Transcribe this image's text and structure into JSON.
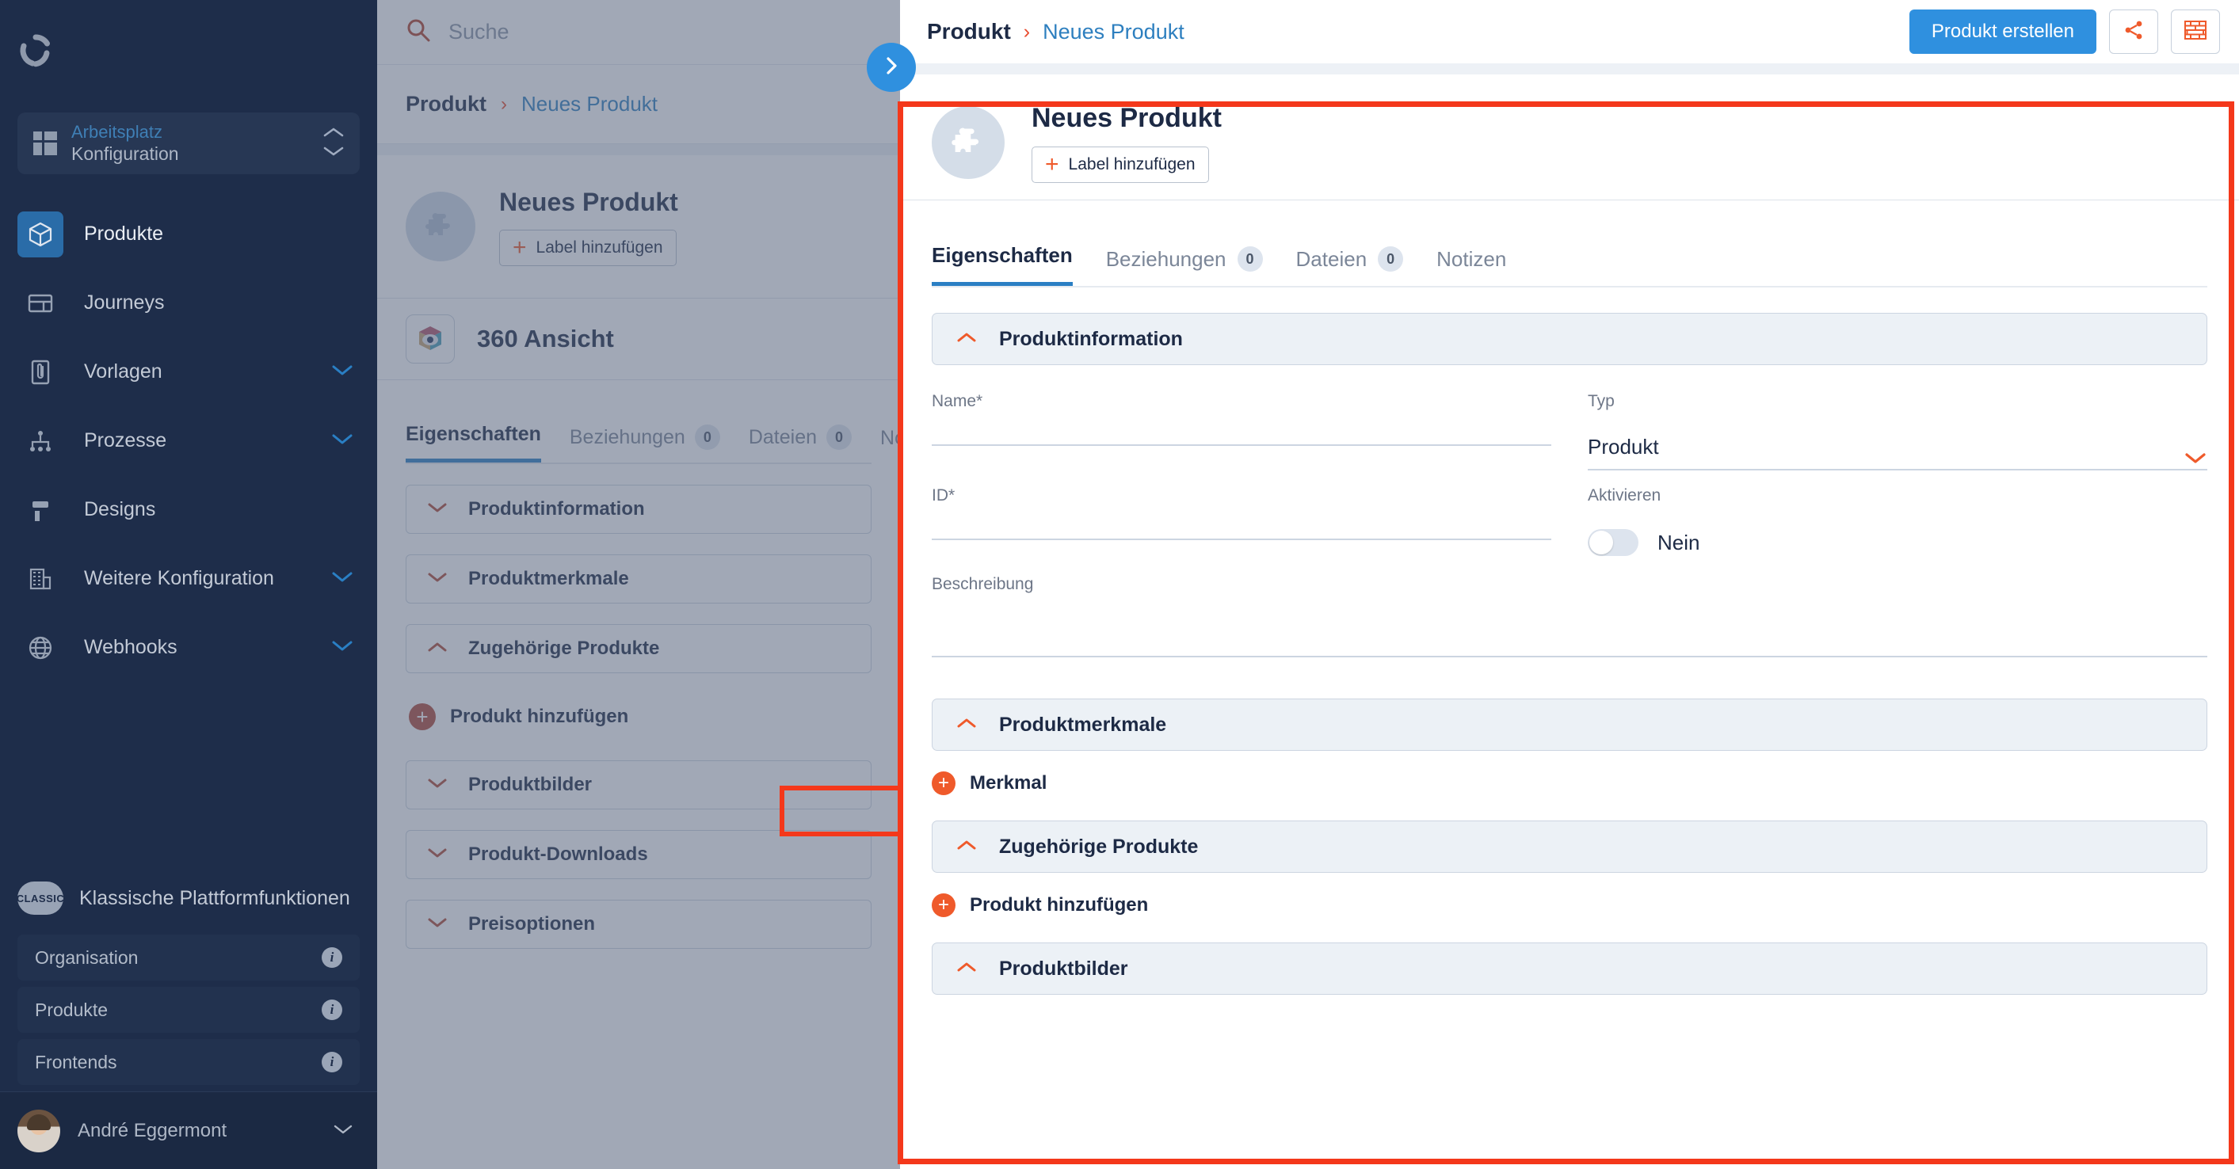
{
  "sidebar": {
    "logo_icon": "cycle-logo-icon",
    "workspace": {
      "icon": "grid-icon",
      "title": "Arbeitsplatz",
      "subtitle": "Konfiguration",
      "chevron_up_icon": "chevron-up-icon",
      "chevron_down_icon": "chevron-down-icon"
    },
    "items": [
      {
        "label": "Produkte",
        "icon": "cube-icon",
        "active": true,
        "caret": false
      },
      {
        "label": "Journeys",
        "icon": "journey-icon",
        "active": false,
        "caret": false
      },
      {
        "label": "Vorlagen",
        "icon": "document-clip-icon",
        "active": false,
        "caret": true
      },
      {
        "label": "Prozesse",
        "icon": "hierarchy-icon",
        "active": false,
        "caret": true
      },
      {
        "label": "Designs",
        "icon": "paint-roller-icon",
        "active": false,
        "caret": false
      },
      {
        "label": "Weitere Konfiguration",
        "icon": "building-icon",
        "active": false,
        "caret": true
      },
      {
        "label": "Webhooks",
        "icon": "globe-icon",
        "active": false,
        "caret": true
      }
    ],
    "classic": {
      "badge": "CLASSIC",
      "label": "Klassische Plattformfunktionen",
      "items": [
        {
          "label": "Organisation",
          "info_icon": "info-icon"
        },
        {
          "label": "Produkte",
          "info_icon": "info-icon"
        },
        {
          "label": "Frontends",
          "info_icon": "info-icon"
        }
      ]
    },
    "user": {
      "name": "André Eggermont",
      "avatar_icon": "user-avatar",
      "chevron_icon": "chevron-down-icon"
    }
  },
  "middle_panel": {
    "search": {
      "icon": "search-icon",
      "placeholder": "Suche",
      "value": ""
    },
    "breadcrumb": {
      "root": "Produkt",
      "separator": "›",
      "leaf": "Neues Produkt"
    },
    "hero": {
      "avatar_icon": "puzzle-piece-icon",
      "title": "Neues Produkt",
      "add_label_button": "Label hinzufügen",
      "plus_icon": "plus-icon"
    },
    "view_card": {
      "icon": "360-view-icon",
      "title": "360 Ansicht"
    },
    "tabs": [
      {
        "label": "Eigenschaften",
        "count": null,
        "active": true
      },
      {
        "label": "Beziehungen",
        "count": "0",
        "active": false
      },
      {
        "label": "Dateien",
        "count": "0",
        "active": false
      },
      {
        "label": "Notizen",
        "count": null,
        "active": false
      }
    ],
    "accordions": [
      {
        "label": "Produktinformation",
        "expanded": false
      },
      {
        "label": "Produktmerkmale",
        "expanded": false
      },
      {
        "label": "Zugehörige Produkte",
        "expanded": true
      }
    ],
    "add_product": {
      "label": "Produkt hinzufügen",
      "icon": "plus-circle-icon",
      "highlighted": true
    },
    "accordions_after": [
      {
        "label": "Produktbilder",
        "expanded": false
      },
      {
        "label": "Produkt-Downloads",
        "expanded": false
      },
      {
        "label": "Preisoptionen",
        "expanded": false
      }
    ],
    "expand_toggle": {
      "icon": "chevron-right-icon"
    }
  },
  "right_panel": {
    "topbar": {
      "breadcrumb_root": "Produkt",
      "breadcrumb_separator": "›",
      "breadcrumb_leaf": "Neues Produkt",
      "primary_button": "Produkt erstellen",
      "share_icon": "share-icon",
      "wall_icon": "brick-wall-icon"
    },
    "hero": {
      "avatar_icon": "puzzle-piece-icon",
      "title": "Neues Produkt",
      "add_label_button": "Label hinzufügen",
      "plus_icon": "plus-icon"
    },
    "tabs": [
      {
        "label": "Eigenschaften",
        "count": null,
        "active": true
      },
      {
        "label": "Beziehungen",
        "count": "0",
        "active": false
      },
      {
        "label": "Dateien",
        "count": "0",
        "active": false
      },
      {
        "label": "Notizen",
        "count": null,
        "active": false
      }
    ],
    "section_product_info": {
      "title": "Produktinformation",
      "chevron_icon": "chevron-up-icon",
      "fields": {
        "name": {
          "label": "Name*",
          "value": "",
          "placeholder": ""
        },
        "typ": {
          "label": "Typ",
          "value": "Produkt",
          "chevron_icon": "chevron-down-icon"
        },
        "id": {
          "label": "ID*",
          "value": "",
          "placeholder": ""
        },
        "aktivieren": {
          "label": "Aktivieren",
          "state_label": "Nein",
          "on": false
        },
        "beschreibung": {
          "label": "Beschreibung",
          "value": "",
          "placeholder": ""
        }
      }
    },
    "section_features": {
      "title": "Produktmerkmale",
      "chevron_icon": "chevron-up-icon",
      "add_label": "Merkmal",
      "add_icon": "plus-circle-icon"
    },
    "section_related": {
      "title": "Zugehörige Produkte",
      "chevron_icon": "chevron-up-icon",
      "add_label": "Produkt hinzufügen",
      "add_icon": "plus-circle-icon"
    },
    "section_images": {
      "title": "Produktbilder",
      "chevron_icon": "chevron-up-icon"
    }
  },
  "colors": {
    "sidebar_bg": "#1e2d4a",
    "accent_blue": "#2f90df",
    "accent_orange": "#ef5a2b",
    "highlight_red": "#f4381b",
    "section_header_bg": "#ecf1f6",
    "overlay_gray": "#7d8698"
  }
}
